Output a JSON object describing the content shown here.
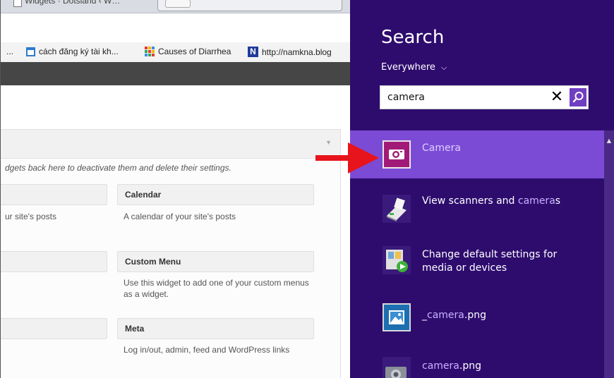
{
  "browser": {
    "tab_title": "Widgets · Dotsland ‹ W…",
    "bookmarks": [
      {
        "label": "...",
        "icon": "none"
      },
      {
        "label": "cách đăng ký tài kh...",
        "icon": "calendar-icon"
      },
      {
        "label": "Causes of Diarrhea",
        "icon": "colorful-grid-icon"
      },
      {
        "label": "http://namkna.blog",
        "icon": "n-logo-icon"
      }
    ],
    "panel": {
      "description": "dgets back here to deactivate them and delete their settings.",
      "widgets": [
        {
          "title": "",
          "desc": "ur site's posts"
        },
        {
          "title": "Calendar",
          "desc": "A calendar of your site's posts"
        },
        {
          "title": "",
          "desc": ""
        },
        {
          "title": "Custom Menu",
          "desc": "Use this widget to add one of your custom menus as a widget."
        },
        {
          "title": "",
          "desc": ""
        },
        {
          "title": "Meta",
          "desc": "Log in/out, admin, feed and WordPress links"
        }
      ]
    }
  },
  "search": {
    "title": "Search",
    "scope": "Everywhere",
    "query": "camera",
    "results": [
      {
        "pre": "",
        "hl": "Camera",
        "post": "",
        "selected": true
      },
      {
        "pre": "View scanners and ",
        "hl": "camera",
        "post": "s",
        "selected": false
      },
      {
        "pre": "Change default settings for media or devices",
        "hl": "",
        "post": "",
        "selected": false
      },
      {
        "pre": "_",
        "hl": "camera",
        "post": ".png",
        "selected": false
      },
      {
        "pre": "",
        "hl": "camera",
        "post": ".png",
        "selected": false
      }
    ]
  },
  "colors": {
    "charm_bg": "#2e0c6e",
    "selected_result": "#7c4bd6",
    "highlight_text": "#c9b0ff",
    "arrow": "#e8141c"
  }
}
